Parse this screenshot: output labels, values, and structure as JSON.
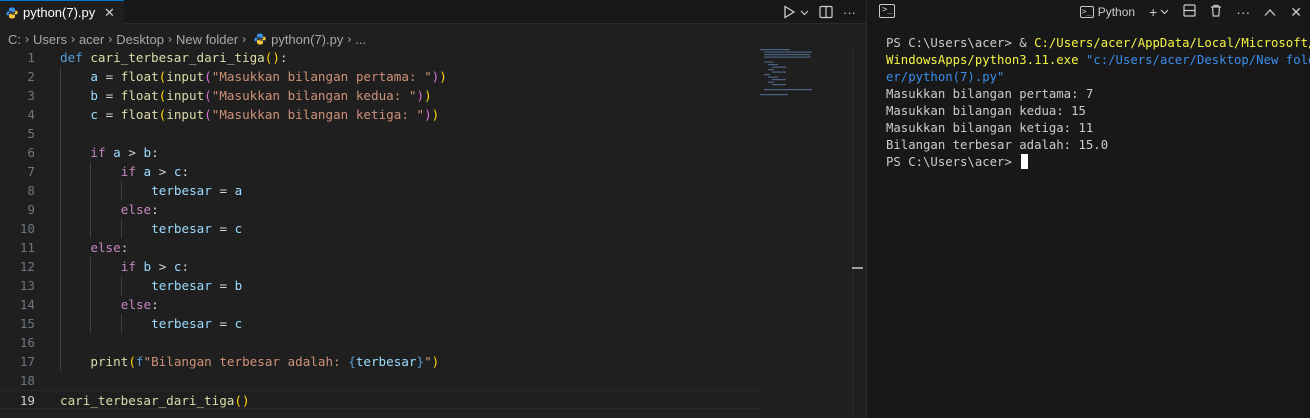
{
  "editor": {
    "tab": {
      "label": "python(7).py",
      "close": "✕"
    },
    "breadcrumb": [
      "C:",
      "Users",
      "acer",
      "Desktop",
      "New folder",
      "python(7).py",
      "..."
    ],
    "lines": [
      {
        "n": "1",
        "indent": 0,
        "tokens": [
          [
            "kw",
            "def "
          ],
          [
            "fn",
            "cari_terbesar_dari_tiga"
          ],
          [
            "b1",
            "()"
          ],
          [
            "txt",
            ":"
          ]
        ]
      },
      {
        "n": "2",
        "indent": 1,
        "tokens": [
          [
            "var",
            "a"
          ],
          [
            "txt",
            " = "
          ],
          [
            "fn",
            "float"
          ],
          [
            "b1",
            "("
          ],
          [
            "fn",
            "input"
          ],
          [
            "b2",
            "("
          ],
          [
            "str",
            "\"Masukkan bilangan pertama: \""
          ],
          [
            "b2",
            ")"
          ],
          [
            "b1",
            ")"
          ]
        ]
      },
      {
        "n": "3",
        "indent": 1,
        "tokens": [
          [
            "var",
            "b"
          ],
          [
            "txt",
            " = "
          ],
          [
            "fn",
            "float"
          ],
          [
            "b1",
            "("
          ],
          [
            "fn",
            "input"
          ],
          [
            "b2",
            "("
          ],
          [
            "str",
            "\"Masukkan bilangan kedua: \""
          ],
          [
            "b2",
            ")"
          ],
          [
            "b1",
            ")"
          ]
        ]
      },
      {
        "n": "4",
        "indent": 1,
        "tokens": [
          [
            "var",
            "c"
          ],
          [
            "txt",
            " = "
          ],
          [
            "fn",
            "float"
          ],
          [
            "b1",
            "("
          ],
          [
            "fn",
            "input"
          ],
          [
            "b2",
            "("
          ],
          [
            "str",
            "\"Masukkan bilangan ketiga: \""
          ],
          [
            "b2",
            ")"
          ],
          [
            "b1",
            ")"
          ]
        ]
      },
      {
        "n": "5",
        "indent": 1,
        "tokens": []
      },
      {
        "n": "6",
        "indent": 1,
        "tokens": [
          [
            "ctl",
            "if "
          ],
          [
            "var",
            "a"
          ],
          [
            "txt",
            " > "
          ],
          [
            "var",
            "b"
          ],
          [
            "txt",
            ":"
          ]
        ]
      },
      {
        "n": "7",
        "indent": 2,
        "tokens": [
          [
            "ctl",
            "if "
          ],
          [
            "var",
            "a"
          ],
          [
            "txt",
            " > "
          ],
          [
            "var",
            "c"
          ],
          [
            "txt",
            ":"
          ]
        ]
      },
      {
        "n": "8",
        "indent": 3,
        "tokens": [
          [
            "var",
            "terbesar"
          ],
          [
            "txt",
            " = "
          ],
          [
            "var",
            "a"
          ]
        ]
      },
      {
        "n": "9",
        "indent": 2,
        "tokens": [
          [
            "ctl",
            "else"
          ],
          [
            "txt",
            ":"
          ]
        ]
      },
      {
        "n": "10",
        "indent": 3,
        "tokens": [
          [
            "var",
            "terbesar"
          ],
          [
            "txt",
            " = "
          ],
          [
            "var",
            "c"
          ]
        ]
      },
      {
        "n": "11",
        "indent": 1,
        "tokens": [
          [
            "ctl",
            "else"
          ],
          [
            "txt",
            ":"
          ]
        ]
      },
      {
        "n": "12",
        "indent": 2,
        "tokens": [
          [
            "ctl",
            "if "
          ],
          [
            "var",
            "b"
          ],
          [
            "txt",
            " > "
          ],
          [
            "var",
            "c"
          ],
          [
            "txt",
            ":"
          ]
        ]
      },
      {
        "n": "13",
        "indent": 3,
        "tokens": [
          [
            "var",
            "terbesar"
          ],
          [
            "txt",
            " = "
          ],
          [
            "var",
            "b"
          ]
        ]
      },
      {
        "n": "14",
        "indent": 2,
        "tokens": [
          [
            "ctl",
            "else"
          ],
          [
            "txt",
            ":"
          ]
        ]
      },
      {
        "n": "15",
        "indent": 3,
        "tokens": [
          [
            "var",
            "terbesar"
          ],
          [
            "txt",
            " = "
          ],
          [
            "var",
            "c"
          ]
        ]
      },
      {
        "n": "16",
        "indent": 1,
        "tokens": []
      },
      {
        "n": "17",
        "indent": 1,
        "tokens": [
          [
            "fn",
            "print"
          ],
          [
            "b1",
            "("
          ],
          [
            "kw",
            "f"
          ],
          [
            "str",
            "\"Bilangan terbesar adalah: "
          ],
          [
            "kw",
            "{"
          ],
          [
            "var",
            "terbesar"
          ],
          [
            "kw",
            "}"
          ],
          [
            "str",
            "\""
          ],
          [
            "b1",
            ")"
          ]
        ]
      },
      {
        "n": "18",
        "indent": 0,
        "tokens": []
      },
      {
        "n": "19",
        "indent": 0,
        "current": true,
        "tokens": [
          [
            "fn",
            "cari_terbesar_dari_tiga"
          ],
          [
            "b1",
            "()"
          ]
        ]
      }
    ]
  },
  "terminal": {
    "shell_label": "Python",
    "lines": [
      [
        [
          "plain",
          "PS C:\\Users\\acer> & "
        ],
        [
          "exe",
          "C:/Users/acer/AppData/Local/Microsoft/"
        ]
      ],
      [
        [
          "exe",
          "WindowsApps/python3.11.exe"
        ],
        [
          "plain",
          " "
        ],
        [
          "arg",
          "\"c:/Users/acer/Desktop/New fold"
        ]
      ],
      [
        [
          "arg",
          "er/python(7).py\""
        ]
      ],
      [
        [
          "plain",
          "Masukkan bilangan pertama: 7"
        ]
      ],
      [
        [
          "plain",
          "Masukkan bilangan kedua: 15"
        ]
      ],
      [
        [
          "plain",
          "Masukkan bilangan ketiga: 11"
        ]
      ],
      [
        [
          "plain",
          "Bilangan terbesar adalah: 15.0"
        ]
      ],
      [
        [
          "plain",
          "PS C:\\Users\\acer> "
        ]
      ]
    ]
  },
  "icons": {
    "python_file": "python-file-icon",
    "run": "▷",
    "dropdown": "⌵",
    "split": "split-editor-icon",
    "more": "···",
    "terminal": ">_",
    "add": "+",
    "trash": "🗑",
    "maximize": "∧",
    "close": "✕"
  },
  "colors": {
    "accent": "#0078d4",
    "editor_bg": "#1f1f1f",
    "terminal_bg": "#181818"
  }
}
